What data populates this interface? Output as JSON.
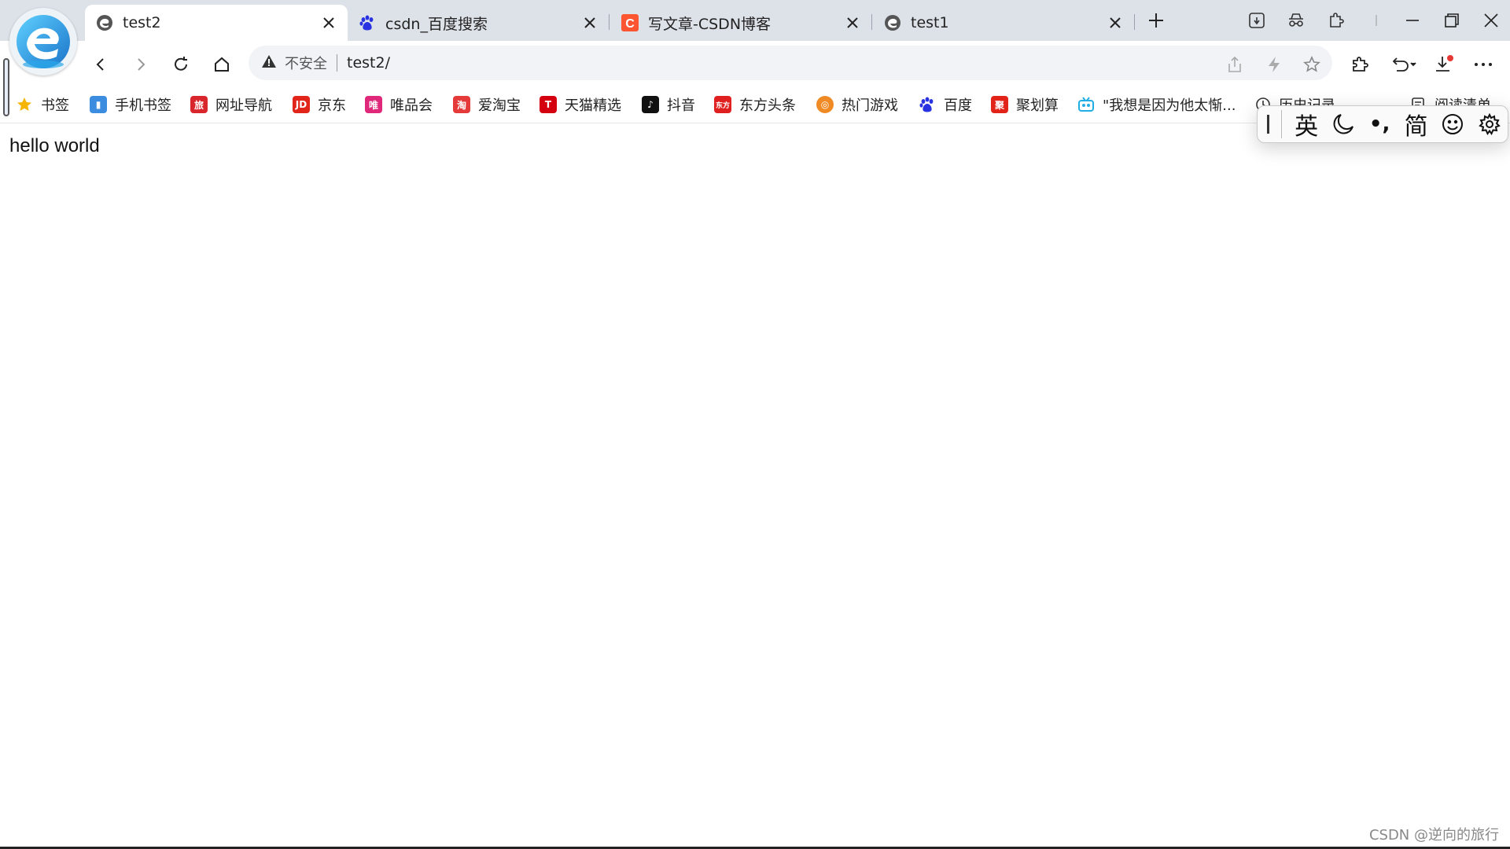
{
  "tabs": [
    {
      "title": "test2",
      "active": true,
      "icon": "edge-icon"
    },
    {
      "title": "csdn_百度搜索",
      "active": false,
      "icon": "baidu-paw-icon"
    },
    {
      "title": "写文章-CSDN博客",
      "active": false,
      "icon": "csdn-icon"
    },
    {
      "title": "test1",
      "active": false,
      "icon": "edge-icon"
    }
  ],
  "address": {
    "security_label": "不安全",
    "url": "test2/"
  },
  "bookmarks": [
    {
      "label": "书签",
      "icon": "star-icon",
      "color": "#f5b400"
    },
    {
      "label": "手机书签",
      "icon": "phone-bookmark-icon",
      "color": "#3c8de0"
    },
    {
      "label": "网址导航",
      "icon": "nav-icon",
      "color": "#d9262c"
    },
    {
      "label": "京东",
      "icon": "jd-icon",
      "color": "#e1251b"
    },
    {
      "label": "唯品会",
      "icon": "vip-icon",
      "color": "#e0287a"
    },
    {
      "label": "爱淘宝",
      "icon": "taobao-icon",
      "color": "#e43a3a"
    },
    {
      "label": "天猫精选",
      "icon": "tmall-icon",
      "color": "#d4000f"
    },
    {
      "label": "抖音",
      "icon": "douyin-icon",
      "color": "#111111"
    },
    {
      "label": "东方头条",
      "icon": "dongfang-icon",
      "color": "#e02020"
    },
    {
      "label": "热门游戏",
      "icon": "game-icon",
      "color": "#f08a24"
    },
    {
      "label": "百度",
      "icon": "baidu-paw-icon",
      "color": "#2932e1"
    },
    {
      "label": "聚划算",
      "icon": "juhuasuan-icon",
      "color": "#e2231a"
    },
    {
      "label": "\"我想是因为他太惭...",
      "icon": "bilibili-icon",
      "color": "#23ade5"
    },
    {
      "label": "历史记录",
      "icon": "history-icon",
      "color": "#333333"
    },
    {
      "label": "阅读清单",
      "icon": "reading-list-icon",
      "color": "#333333"
    }
  ],
  "content": {
    "text": "hello world"
  },
  "ime": {
    "mode": "英",
    "punct": "•,",
    "script": "简"
  },
  "watermark": "CSDN @逆向的旅行",
  "colors": {
    "tabstrip": "#dde2e9",
    "address_bg": "#f1f3f6",
    "accent_blue": "#1a73c9"
  }
}
